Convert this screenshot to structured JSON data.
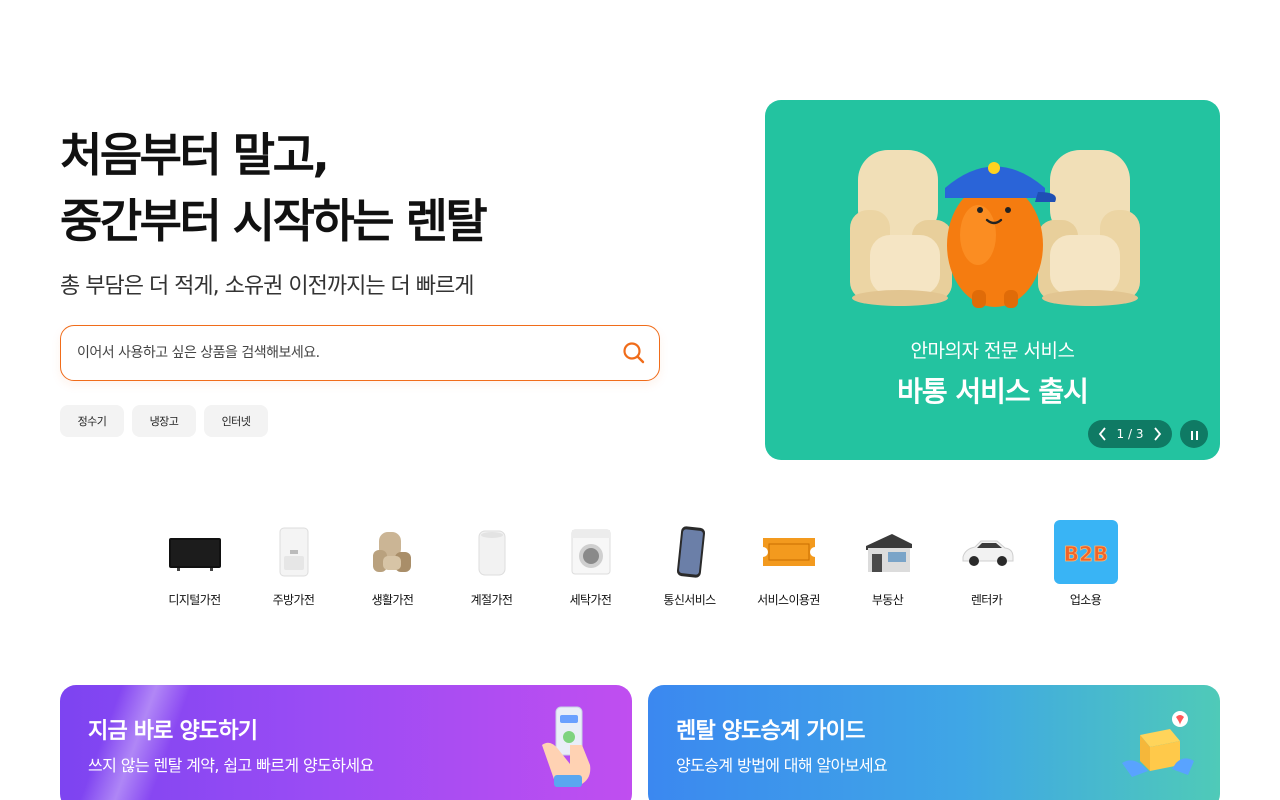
{
  "hero": {
    "title_line1": "처음부터 말고,",
    "title_line2": "중간부터 시작하는 렌탈",
    "subtitle": "총 부담은 더 적게, 소유권 이전까지는 더 빠르게"
  },
  "search": {
    "placeholder": "이어서 사용하고 싶은 상품을 검색해보세요.",
    "value": ""
  },
  "chips": [
    "정수기",
    "냉장고",
    "인터넷"
  ],
  "banner": {
    "subtitle": "안마의자 전문 서비스",
    "title": "바통 서비스 출시",
    "page_current": "1",
    "page_total": "3",
    "page_separator": "/",
    "background": "#23c3a0"
  },
  "categories": [
    {
      "label": "디지털가전",
      "icon": "tv-icon"
    },
    {
      "label": "주방가전",
      "icon": "water-purifier-icon"
    },
    {
      "label": "생활가전",
      "icon": "massage-chair-icon"
    },
    {
      "label": "계절가전",
      "icon": "air-purifier-icon"
    },
    {
      "label": "세탁가전",
      "icon": "washing-machine-icon"
    },
    {
      "label": "통신서비스",
      "icon": "smartphone-icon"
    },
    {
      "label": "서비스이용권",
      "icon": "ticket-icon"
    },
    {
      "label": "부동산",
      "icon": "house-icon"
    },
    {
      "label": "렌터카",
      "icon": "car-icon"
    },
    {
      "label": "업소용",
      "icon": "b2b-icon",
      "badge_text": "B2B"
    }
  ],
  "cards": {
    "left": {
      "title": "지금 바로 양도하기",
      "subtitle": "쓰지 않는 렌탈 계약, 쉽고 빠르게 양도하세요"
    },
    "right": {
      "title": "렌탈 양도승계 가이드",
      "subtitle": "양도승계 방법에 대해 알아보세요"
    }
  },
  "colors": {
    "accent": "#f06c1a",
    "banner": "#23c3a0",
    "card_left": "#9a4cf4",
    "card_right": "#3fa6e6"
  }
}
